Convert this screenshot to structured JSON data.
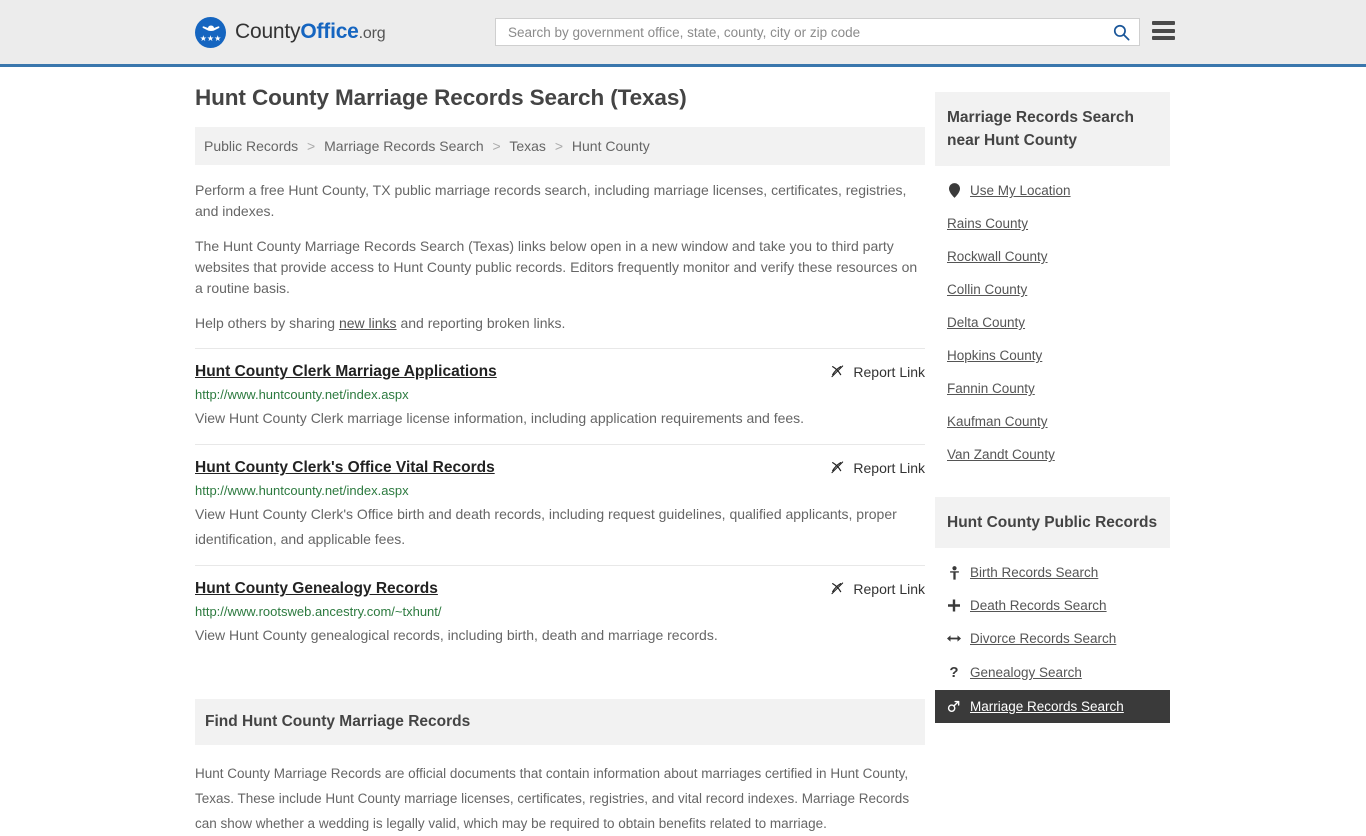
{
  "header": {
    "logo": {
      "text_part1": "County",
      "text_part2": "Office",
      "text_tld": ".org",
      "stars": "★★★",
      "icon": "eagle-seal-icon"
    },
    "search": {
      "placeholder": "Search by government office, state, county, city or zip code",
      "value": "",
      "search_icon": "search-icon"
    },
    "menu_icon": "hamburger-menu-icon"
  },
  "main": {
    "title": "Hunt County Marriage Records Search (Texas)",
    "breadcrumb": {
      "separator": ">",
      "items": [
        "Public Records",
        "Marriage Records Search",
        "Texas",
        "Hunt County"
      ]
    },
    "paragraphs": {
      "p1": "Perform a free Hunt County, TX public marriage records search, including marriage licenses, certificates, registries, and indexes.",
      "p2": "The Hunt County Marriage Records Search (Texas) links below open in a new window and take you to third party websites that provide access to Hunt County public records. Editors frequently monitor and verify these resources on a routine basis.",
      "p3_before": "Help others by sharing ",
      "p3_link": "new links",
      "p3_after": " and reporting broken links."
    },
    "report_link_label": "Report Link",
    "report_link_icon": "broken-link-icon",
    "results": [
      {
        "title": "Hunt County Clerk Marriage Applications",
        "url": "http://www.huntcounty.net/index.aspx",
        "description": "View Hunt County Clerk marriage license information, including application requirements and fees."
      },
      {
        "title": "Hunt County Clerk's Office Vital Records",
        "url": "http://www.huntcounty.net/index.aspx",
        "description": "View Hunt County Clerk's Office birth and death records, including request guidelines, qualified applicants, proper identification, and applicable fees."
      },
      {
        "title": "Hunt County Genealogy Records",
        "url": "http://www.rootsweb.ancestry.com/~txhunt/",
        "description": "View Hunt County genealogical records, including birth, death and marriage records."
      }
    ],
    "find_section": {
      "heading": "Find Hunt County Marriage Records",
      "text": "Hunt County Marriage Records are official documents that contain information about marriages certified in Hunt County, Texas. These include Hunt County marriage licenses, certificates, registries, and vital record indexes. Marriage Records can show whether a wedding is legally valid, which may be required to obtain benefits related to marriage."
    }
  },
  "sidebar": {
    "nearby": {
      "heading": "Marriage Records Search near Hunt County",
      "use_my_location": {
        "label": "Use My Location",
        "icon": "map-pin-icon"
      },
      "counties": [
        "Rains County",
        "Rockwall County",
        "Collin County",
        "Delta County",
        "Hopkins County",
        "Fannin County",
        "Kaufman County",
        "Van Zandt County"
      ]
    },
    "public_records": {
      "heading": "Hunt County Public Records",
      "items": [
        {
          "label": "Birth Records Search",
          "icon": "baby-icon",
          "glyph": "Ɣ",
          "active": false
        },
        {
          "label": "Death Records Search",
          "icon": "cross-icon",
          "glyph": "✚",
          "active": false
        },
        {
          "label": "Divorce Records Search",
          "icon": "left-right-arrow-icon",
          "glyph": "↔",
          "active": false
        },
        {
          "label": "Genealogy Search",
          "icon": "question-mark-icon",
          "glyph": "?",
          "active": false
        },
        {
          "label": "Marriage Records Search",
          "icon": "male-female-symbol-icon",
          "glyph": "⚤",
          "active": true
        }
      ]
    }
  },
  "colors": {
    "brand_blue": "#1565c0",
    "header_bg": "#ececec",
    "header_border": "#3a77ad",
    "url_green": "#2c7a3f",
    "panel_gray": "#f2f2f2",
    "active_dark": "#3a3a3a"
  }
}
